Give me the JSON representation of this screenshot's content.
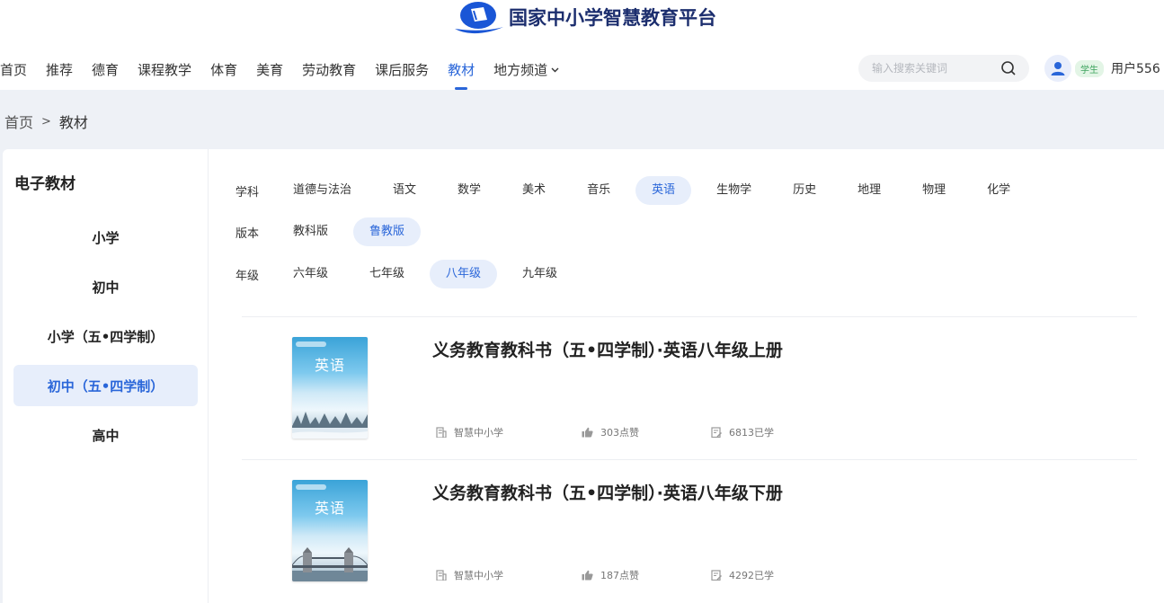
{
  "header": {
    "logo_text": "国家中小学智慧教育平台",
    "nav": [
      "首页",
      "推荐",
      "德育",
      "课程教学",
      "体育",
      "美育",
      "劳动教育",
      "课后服务",
      "教材",
      "地方频道"
    ],
    "active_nav": "教材",
    "search_placeholder": "输入搜索关键词",
    "role_badge": "学生",
    "username": "用户556"
  },
  "breadcrumb": {
    "home": "首页",
    "separator": ">",
    "current": "教材"
  },
  "sidebar": {
    "title": "电子教材",
    "items": [
      "小学",
      "初中",
      "小学（五•四学制）",
      "初中（五•四学制）",
      "高中"
    ],
    "active": "初中（五•四学制）"
  },
  "filters": {
    "subject": {
      "label": "学科",
      "options": [
        "道德与法治",
        "语文",
        "数学",
        "美术",
        "音乐",
        "英语",
        "生物学",
        "历史",
        "地理",
        "物理",
        "化学"
      ],
      "selected": "英语"
    },
    "edition": {
      "label": "版本",
      "options": [
        "教科版",
        "鲁教版"
      ],
      "selected": "鲁教版"
    },
    "grade": {
      "label": "年级",
      "options": [
        "六年级",
        "七年级",
        "八年级",
        "九年级"
      ],
      "selected": "八年级"
    }
  },
  "books": [
    {
      "title": "义务教育教科书（五•四学制）·英语八年级上册",
      "cover_text": "英语",
      "publisher": "智慧中小学",
      "likes": "303点赞",
      "learners": "6813已学"
    },
    {
      "title": "义务教育教科书（五•四学制）·英语八年级下册",
      "cover_text": "英语",
      "publisher": "智慧中小学",
      "likes": "187点赞",
      "learners": "4292已学"
    }
  ],
  "colors": {
    "accent": "#2a66d9",
    "active_bg": "#e7eefb",
    "page_bg": "#eef1f6",
    "logo_text": "#1c2e6e",
    "badge_green": "#3da35d"
  },
  "icons": [
    "logo-icon",
    "search-icon",
    "user-avatar-icon",
    "chevron-down-icon",
    "building-icon",
    "thumbs-up-icon",
    "study-record-icon"
  ]
}
